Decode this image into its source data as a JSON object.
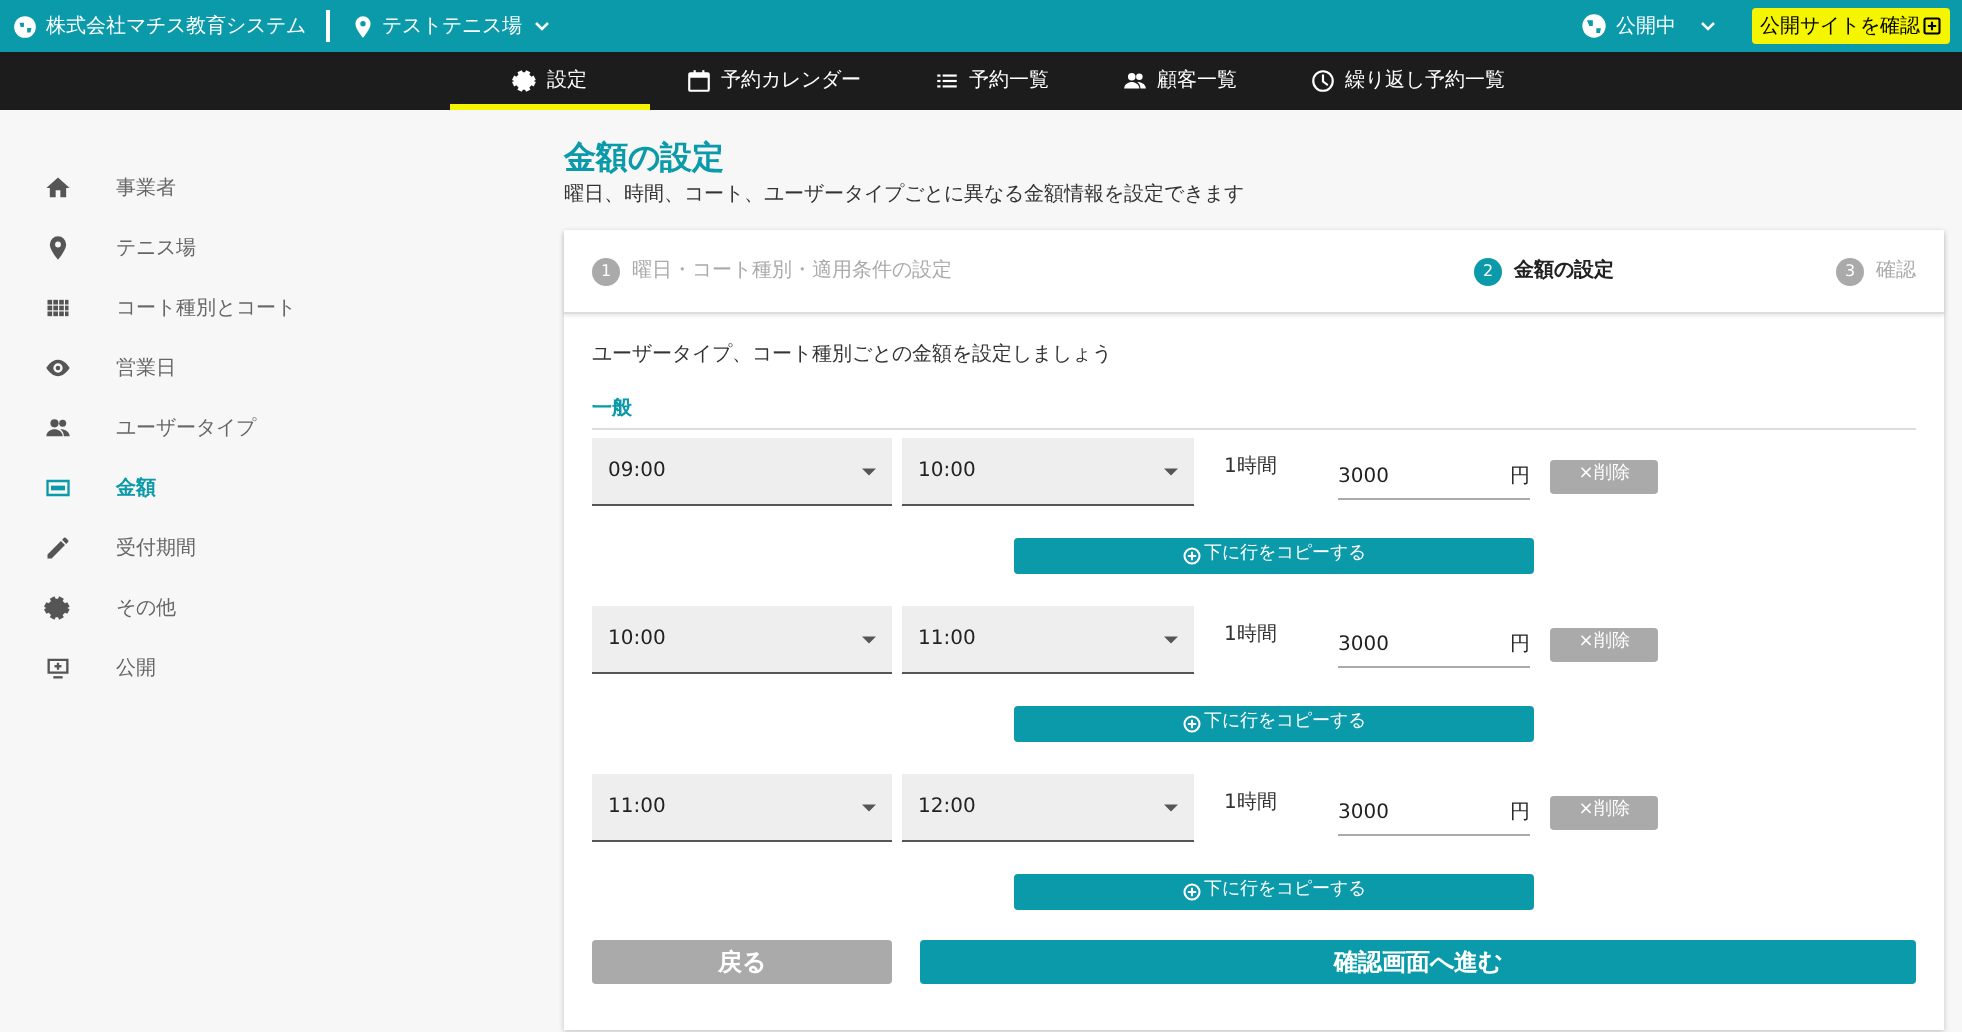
{
  "header": {
    "company": "株式会社マチス教育システム",
    "venue": "テストテニス場",
    "publish_status": "公開中",
    "site_button": "公開サイトを確認"
  },
  "nav_tabs": [
    {
      "label": "設定",
      "selected": true
    },
    {
      "label": "予約カレンダー",
      "selected": false
    },
    {
      "label": "予約一覧",
      "selected": false
    },
    {
      "label": "顧客一覧",
      "selected": false
    },
    {
      "label": "繰り返し予約一覧",
      "selected": false
    }
  ],
  "sidebar": {
    "items": [
      {
        "label": "事業者",
        "selected": false
      },
      {
        "label": "テニス場",
        "selected": false
      },
      {
        "label": "コート種別とコート",
        "selected": false
      },
      {
        "label": "営業日",
        "selected": false
      },
      {
        "label": "ユーザータイプ",
        "selected": false
      },
      {
        "label": "金額",
        "selected": true
      },
      {
        "label": "受付期間",
        "selected": false
      },
      {
        "label": "その他",
        "selected": false
      },
      {
        "label": "公開",
        "selected": false
      }
    ]
  },
  "page": {
    "title": "金額の設定",
    "subtitle": "曜日、時間、コート、ユーザータイプごとに異なる金額情報を設定できます"
  },
  "steps": [
    {
      "number": "1",
      "label": "曜日・コート種別・適用条件の設定",
      "selected": false
    },
    {
      "number": "2",
      "label": "金額の設定",
      "selected": true
    },
    {
      "number": "3",
      "label": "確認",
      "selected": false
    }
  ],
  "instruction": "ユーザータイプ、コート種別ごとの金額を設定しましょう",
  "section_title": "一般",
  "rows": [
    {
      "start": "09:00",
      "end": "10:00",
      "duration": "1時間",
      "price": "3000",
      "unit": "円",
      "delete": "×削除",
      "copy": "下に行をコピーする"
    },
    {
      "start": "10:00",
      "end": "11:00",
      "duration": "1時間",
      "price": "3000",
      "unit": "円",
      "delete": "×削除",
      "copy": "下に行をコピーする"
    },
    {
      "start": "11:00",
      "end": "12:00",
      "duration": "1時間",
      "price": "3000",
      "unit": "円",
      "delete": "×削除",
      "copy": "下に行をコピーする"
    }
  ],
  "buttons": {
    "back": "戻る",
    "next": "確認画面へ進む"
  }
}
